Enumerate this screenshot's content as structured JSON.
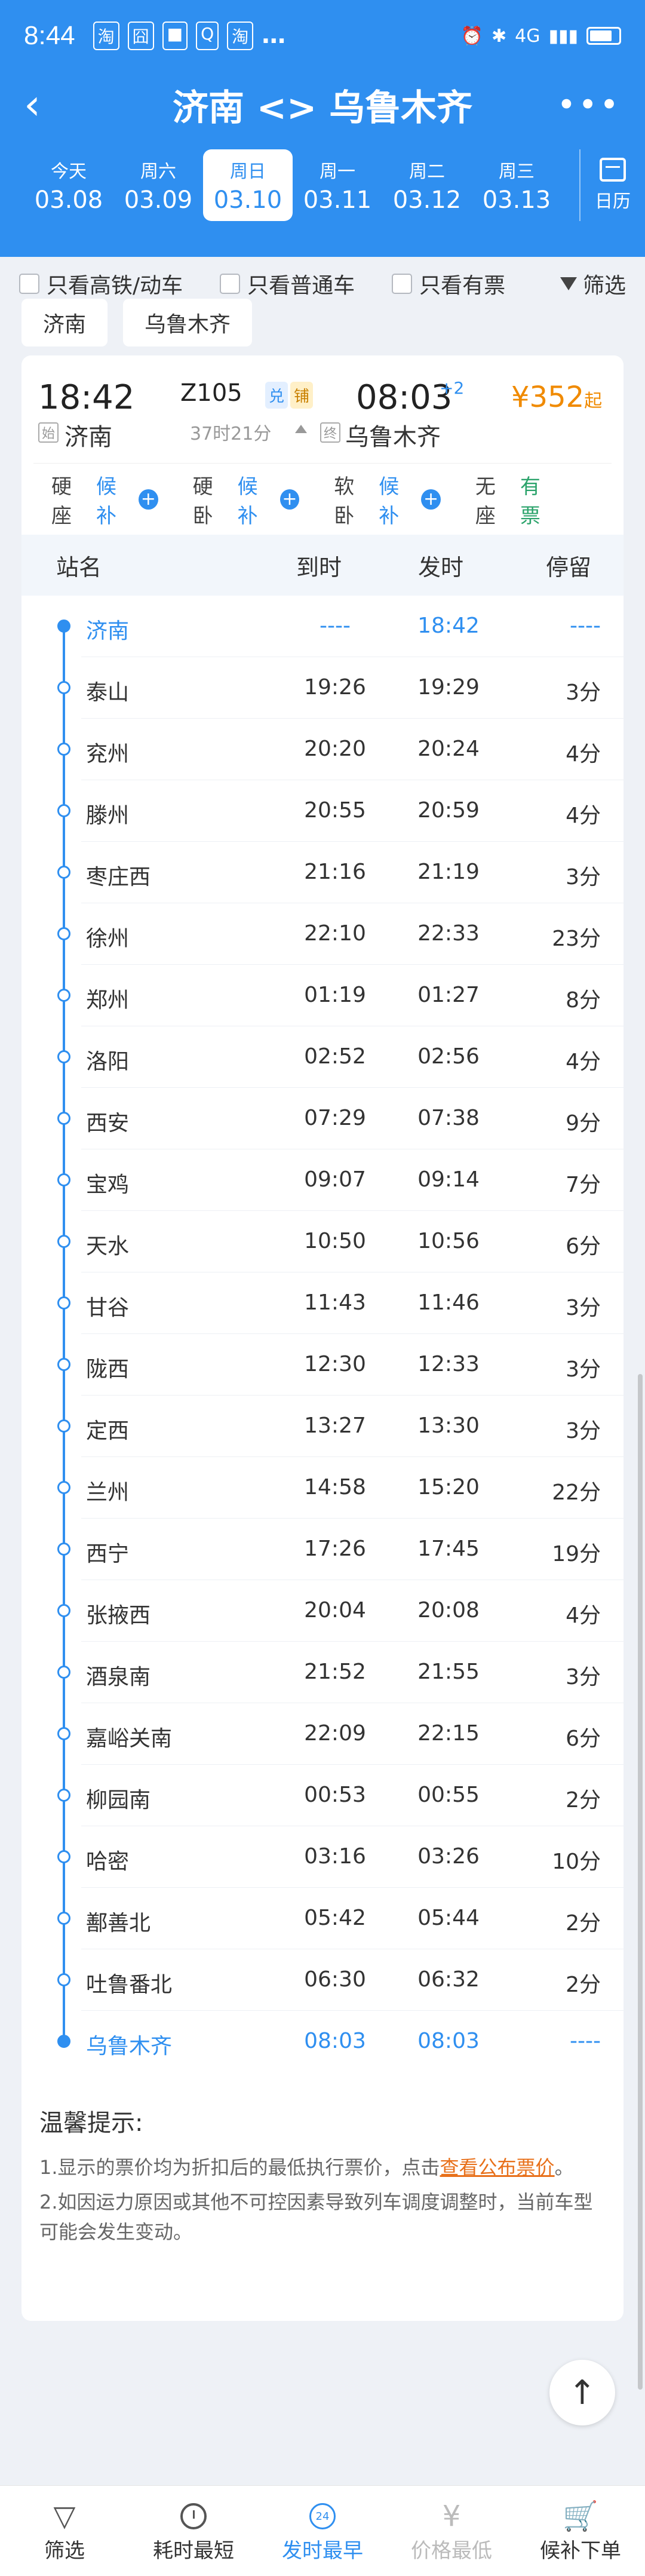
{
  "status": {
    "time": "8:44",
    "notif_icons": [
      "淘",
      "囧",
      "■",
      "Q",
      "淘"
    ],
    "more": "…",
    "signal": "4G",
    "battery": ""
  },
  "nav": {
    "back": "‹",
    "title": "济南 <> 乌鲁木齐",
    "more": "•••"
  },
  "dates": [
    {
      "weekday": "今天",
      "date": "03.08",
      "active": false
    },
    {
      "weekday": "周六",
      "date": "03.09",
      "active": false
    },
    {
      "weekday": "周日",
      "date": "03.10",
      "active": true
    },
    {
      "weekday": "周一",
      "date": "03.11",
      "active": false
    },
    {
      "weekday": "周二",
      "date": "03.12",
      "active": false
    },
    {
      "weekday": "周三",
      "date": "03.13",
      "active": false
    }
  ],
  "calendar_label": "日历",
  "filters": {
    "high_speed": "只看高铁/动车",
    "normal": "只看普通车",
    "available": "只看有票",
    "filter_btn": "筛选"
  },
  "tags": {
    "from": "济南",
    "to": "乌鲁木齐"
  },
  "train": {
    "dep_time": "18:42",
    "arr_time": "08:03",
    "arr_plus": "+2",
    "number": "Z105",
    "badge1": "兑",
    "badge2": "铺",
    "duration": "37时21分",
    "price": "¥352",
    "price_unit": "起",
    "start_tag": "始",
    "end_tag": "终",
    "from": "济南",
    "to": "乌鲁木齐"
  },
  "seats": [
    {
      "type": "硬座",
      "status": "候补",
      "plus": "+"
    },
    {
      "type": "硬卧",
      "status": "候补",
      "plus": "+"
    },
    {
      "type": "软卧",
      "status": "候补",
      "plus": "+"
    },
    {
      "type": "无座",
      "status": "有票",
      "plus": ""
    }
  ],
  "table_head": {
    "name": "站名",
    "arr": "到时",
    "dep": "发时",
    "stay": "停留"
  },
  "stations": [
    {
      "name": "济南",
      "arr": "----",
      "dep": "18:42",
      "stay": "----"
    },
    {
      "name": "泰山",
      "arr": "19:26",
      "dep": "19:29",
      "stay": "3分"
    },
    {
      "name": "兖州",
      "arr": "20:20",
      "dep": "20:24",
      "stay": "4分"
    },
    {
      "name": "滕州",
      "arr": "20:55",
      "dep": "20:59",
      "stay": "4分"
    },
    {
      "name": "枣庄西",
      "arr": "21:16",
      "dep": "21:19",
      "stay": "3分"
    },
    {
      "name": "徐州",
      "arr": "22:10",
      "dep": "22:33",
      "stay": "23分"
    },
    {
      "name": "郑州",
      "arr": "01:19",
      "dep": "01:27",
      "stay": "8分"
    },
    {
      "name": "洛阳",
      "arr": "02:52",
      "dep": "02:56",
      "stay": "4分"
    },
    {
      "name": "西安",
      "arr": "07:29",
      "dep": "07:38",
      "stay": "9分"
    },
    {
      "name": "宝鸡",
      "arr": "09:07",
      "dep": "09:14",
      "stay": "7分"
    },
    {
      "name": "天水",
      "arr": "10:50",
      "dep": "10:56",
      "stay": "6分"
    },
    {
      "name": "甘谷",
      "arr": "11:43",
      "dep": "11:46",
      "stay": "3分"
    },
    {
      "name": "陇西",
      "arr": "12:30",
      "dep": "12:33",
      "stay": "3分"
    },
    {
      "name": "定西",
      "arr": "13:27",
      "dep": "13:30",
      "stay": "3分"
    },
    {
      "name": "兰州",
      "arr": "14:58",
      "dep": "15:20",
      "stay": "22分"
    },
    {
      "name": "西宁",
      "arr": "17:26",
      "dep": "17:45",
      "stay": "19分"
    },
    {
      "name": "张掖西",
      "arr": "20:04",
      "dep": "20:08",
      "stay": "4分"
    },
    {
      "name": "酒泉南",
      "arr": "21:52",
      "dep": "21:55",
      "stay": "3分"
    },
    {
      "name": "嘉峪关南",
      "arr": "22:09",
      "dep": "22:15",
      "stay": "6分"
    },
    {
      "name": "柳园南",
      "arr": "00:53",
      "dep": "00:55",
      "stay": "2分"
    },
    {
      "name": "哈密",
      "arr": "03:16",
      "dep": "03:26",
      "stay": "10分"
    },
    {
      "name": "鄯善北",
      "arr": "05:42",
      "dep": "05:44",
      "stay": "2分"
    },
    {
      "name": "吐鲁番北",
      "arr": "06:30",
      "dep": "06:32",
      "stay": "2分"
    },
    {
      "name": "乌鲁木齐",
      "arr": "08:03",
      "dep": "08:03",
      "stay": "----"
    }
  ],
  "tips": {
    "title": "温馨提示:",
    "line1_prefix": "1.显示的票价均为折扣后的最低执行票价，点击",
    "line1_link": "查看公布票价",
    "line1_suffix": "。",
    "line2": "2.如因运力原因或其他不可控因素导致列车调度调整时，当前车型可能会发生变动。"
  },
  "to_top": "↑",
  "tabbar": [
    {
      "label": "筛选",
      "icon": "▽"
    },
    {
      "label": "耗时最短",
      "icon": ""
    },
    {
      "label": "发时最早",
      "icon": "24"
    },
    {
      "label": "价格最低",
      "icon": "¥"
    },
    {
      "label": "候补下单",
      "icon": "🛒"
    }
  ]
}
